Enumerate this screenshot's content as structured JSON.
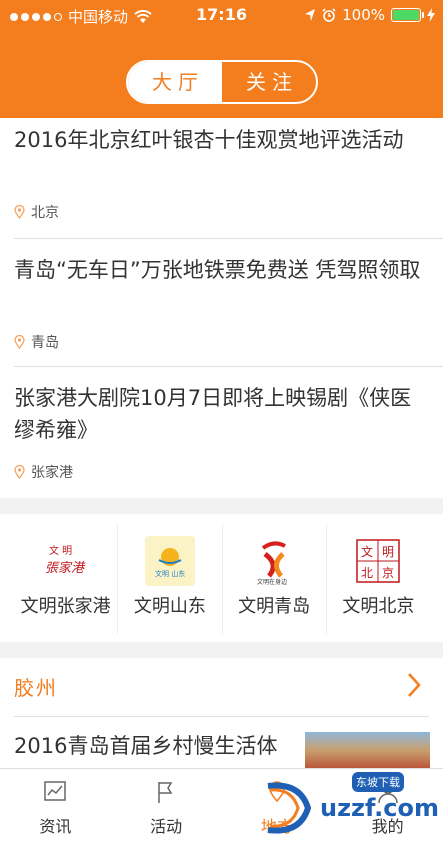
{
  "status": {
    "carrier": "中国移动",
    "time": "17:16",
    "battery": "100%"
  },
  "segment": {
    "tabs": [
      {
        "label": "大厅"
      },
      {
        "label": "关注"
      }
    ]
  },
  "news": [
    {
      "title": "2016年北京红叶银杏十佳观赏地评选活动",
      "location": "北京"
    },
    {
      "title": "青岛“无车日”万张地铁票免费送 凭驾照领取",
      "location": "青岛"
    },
    {
      "title": "张家港大剧院10月7日即将上映锡剧《侠医缪希雍》",
      "location": "张家港"
    }
  ],
  "logos": [
    {
      "label": "文明张家港",
      "icon": "wenming-zhangjiagang-logo"
    },
    {
      "label": "文明山东",
      "icon": "wenming-shandong-logo"
    },
    {
      "label": "文明青岛",
      "icon": "wenming-qingdao-logo"
    },
    {
      "label": "文明北京",
      "icon": "wenming-beijing-logo"
    }
  ],
  "region": {
    "title": "胶州",
    "news_title": "2016青岛首届乡村慢生活体"
  },
  "tabbar": [
    {
      "label": "资讯",
      "icon": "news-chart-icon"
    },
    {
      "label": "活动",
      "icon": "flag-icon"
    },
    {
      "label": "地方",
      "icon": "map-icon"
    },
    {
      "label": "我的",
      "icon": "person-icon"
    }
  ],
  "watermark": {
    "text": "uzzf.com",
    "tag": "东坡下载"
  },
  "colors": {
    "accent": "#f47d1d",
    "battery": "#4cd964"
  }
}
